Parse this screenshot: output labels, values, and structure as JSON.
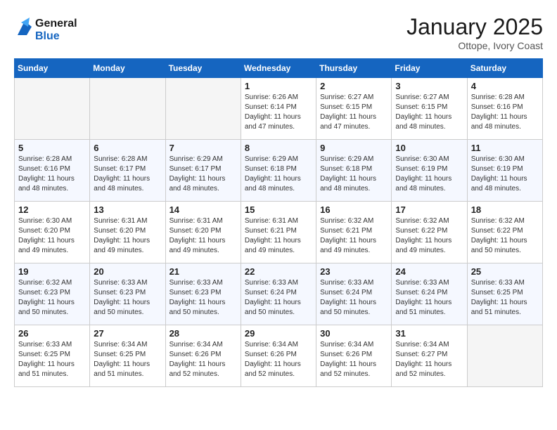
{
  "header": {
    "logo_line1": "General",
    "logo_line2": "Blue",
    "month_title": "January 2025",
    "subtitle": "Ottope, Ivory Coast"
  },
  "weekdays": [
    "Sunday",
    "Monday",
    "Tuesday",
    "Wednesday",
    "Thursday",
    "Friday",
    "Saturday"
  ],
  "weeks": [
    [
      {
        "num": "",
        "sunrise": "",
        "sunset": "",
        "daylight": "",
        "empty": true
      },
      {
        "num": "",
        "sunrise": "",
        "sunset": "",
        "daylight": "",
        "empty": true
      },
      {
        "num": "",
        "sunrise": "",
        "sunset": "",
        "daylight": "",
        "empty": true
      },
      {
        "num": "1",
        "sunrise": "Sunrise: 6:26 AM",
        "sunset": "Sunset: 6:14 PM",
        "daylight": "Daylight: 11 hours and 47 minutes."
      },
      {
        "num": "2",
        "sunrise": "Sunrise: 6:27 AM",
        "sunset": "Sunset: 6:15 PM",
        "daylight": "Daylight: 11 hours and 47 minutes."
      },
      {
        "num": "3",
        "sunrise": "Sunrise: 6:27 AM",
        "sunset": "Sunset: 6:15 PM",
        "daylight": "Daylight: 11 hours and 48 minutes."
      },
      {
        "num": "4",
        "sunrise": "Sunrise: 6:28 AM",
        "sunset": "Sunset: 6:16 PM",
        "daylight": "Daylight: 11 hours and 48 minutes."
      }
    ],
    [
      {
        "num": "5",
        "sunrise": "Sunrise: 6:28 AM",
        "sunset": "Sunset: 6:16 PM",
        "daylight": "Daylight: 11 hours and 48 minutes."
      },
      {
        "num": "6",
        "sunrise": "Sunrise: 6:28 AM",
        "sunset": "Sunset: 6:17 PM",
        "daylight": "Daylight: 11 hours and 48 minutes."
      },
      {
        "num": "7",
        "sunrise": "Sunrise: 6:29 AM",
        "sunset": "Sunset: 6:17 PM",
        "daylight": "Daylight: 11 hours and 48 minutes."
      },
      {
        "num": "8",
        "sunrise": "Sunrise: 6:29 AM",
        "sunset": "Sunset: 6:18 PM",
        "daylight": "Daylight: 11 hours and 48 minutes."
      },
      {
        "num": "9",
        "sunrise": "Sunrise: 6:29 AM",
        "sunset": "Sunset: 6:18 PM",
        "daylight": "Daylight: 11 hours and 48 minutes."
      },
      {
        "num": "10",
        "sunrise": "Sunrise: 6:30 AM",
        "sunset": "Sunset: 6:19 PM",
        "daylight": "Daylight: 11 hours and 48 minutes."
      },
      {
        "num": "11",
        "sunrise": "Sunrise: 6:30 AM",
        "sunset": "Sunset: 6:19 PM",
        "daylight": "Daylight: 11 hours and 48 minutes."
      }
    ],
    [
      {
        "num": "12",
        "sunrise": "Sunrise: 6:30 AM",
        "sunset": "Sunset: 6:20 PM",
        "daylight": "Daylight: 11 hours and 49 minutes."
      },
      {
        "num": "13",
        "sunrise": "Sunrise: 6:31 AM",
        "sunset": "Sunset: 6:20 PM",
        "daylight": "Daylight: 11 hours and 49 minutes."
      },
      {
        "num": "14",
        "sunrise": "Sunrise: 6:31 AM",
        "sunset": "Sunset: 6:20 PM",
        "daylight": "Daylight: 11 hours and 49 minutes."
      },
      {
        "num": "15",
        "sunrise": "Sunrise: 6:31 AM",
        "sunset": "Sunset: 6:21 PM",
        "daylight": "Daylight: 11 hours and 49 minutes."
      },
      {
        "num": "16",
        "sunrise": "Sunrise: 6:32 AM",
        "sunset": "Sunset: 6:21 PM",
        "daylight": "Daylight: 11 hours and 49 minutes."
      },
      {
        "num": "17",
        "sunrise": "Sunrise: 6:32 AM",
        "sunset": "Sunset: 6:22 PM",
        "daylight": "Daylight: 11 hours and 49 minutes."
      },
      {
        "num": "18",
        "sunrise": "Sunrise: 6:32 AM",
        "sunset": "Sunset: 6:22 PM",
        "daylight": "Daylight: 11 hours and 50 minutes."
      }
    ],
    [
      {
        "num": "19",
        "sunrise": "Sunrise: 6:32 AM",
        "sunset": "Sunset: 6:23 PM",
        "daylight": "Daylight: 11 hours and 50 minutes."
      },
      {
        "num": "20",
        "sunrise": "Sunrise: 6:33 AM",
        "sunset": "Sunset: 6:23 PM",
        "daylight": "Daylight: 11 hours and 50 minutes."
      },
      {
        "num": "21",
        "sunrise": "Sunrise: 6:33 AM",
        "sunset": "Sunset: 6:23 PM",
        "daylight": "Daylight: 11 hours and 50 minutes."
      },
      {
        "num": "22",
        "sunrise": "Sunrise: 6:33 AM",
        "sunset": "Sunset: 6:24 PM",
        "daylight": "Daylight: 11 hours and 50 minutes."
      },
      {
        "num": "23",
        "sunrise": "Sunrise: 6:33 AM",
        "sunset": "Sunset: 6:24 PM",
        "daylight": "Daylight: 11 hours and 50 minutes."
      },
      {
        "num": "24",
        "sunrise": "Sunrise: 6:33 AM",
        "sunset": "Sunset: 6:24 PM",
        "daylight": "Daylight: 11 hours and 51 minutes."
      },
      {
        "num": "25",
        "sunrise": "Sunrise: 6:33 AM",
        "sunset": "Sunset: 6:25 PM",
        "daylight": "Daylight: 11 hours and 51 minutes."
      }
    ],
    [
      {
        "num": "26",
        "sunrise": "Sunrise: 6:33 AM",
        "sunset": "Sunset: 6:25 PM",
        "daylight": "Daylight: 11 hours and 51 minutes."
      },
      {
        "num": "27",
        "sunrise": "Sunrise: 6:34 AM",
        "sunset": "Sunset: 6:25 PM",
        "daylight": "Daylight: 11 hours and 51 minutes."
      },
      {
        "num": "28",
        "sunrise": "Sunrise: 6:34 AM",
        "sunset": "Sunset: 6:26 PM",
        "daylight": "Daylight: 11 hours and 52 minutes."
      },
      {
        "num": "29",
        "sunrise": "Sunrise: 6:34 AM",
        "sunset": "Sunset: 6:26 PM",
        "daylight": "Daylight: 11 hours and 52 minutes."
      },
      {
        "num": "30",
        "sunrise": "Sunrise: 6:34 AM",
        "sunset": "Sunset: 6:26 PM",
        "daylight": "Daylight: 11 hours and 52 minutes."
      },
      {
        "num": "31",
        "sunrise": "Sunrise: 6:34 AM",
        "sunset": "Sunset: 6:27 PM",
        "daylight": "Daylight: 11 hours and 52 minutes."
      },
      {
        "num": "",
        "sunrise": "",
        "sunset": "",
        "daylight": "",
        "empty": true
      }
    ]
  ]
}
